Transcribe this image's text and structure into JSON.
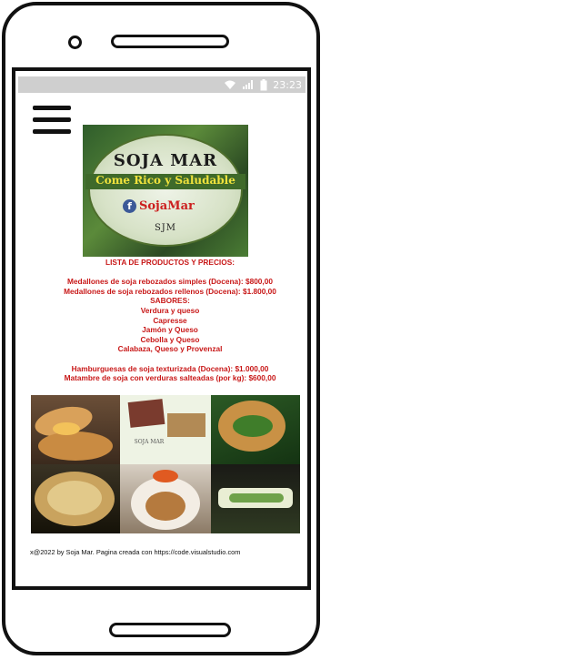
{
  "status_bar": {
    "time": "23:23",
    "icons": [
      "wifi-icon",
      "signal-icon",
      "battery-icon"
    ]
  },
  "menu": {
    "icon": "hamburger-menu-icon"
  },
  "logo": {
    "title": "SOJA MAR",
    "slogan": "Come Rico y Saludable",
    "facebook_name": "SojaMar",
    "monogram": "SJM"
  },
  "products": {
    "heading": "LISTA DE PRODUCTOS Y PRECIOS:",
    "items_a": [
      "Medallones de soja rebozados simples (Docena): $800,00",
      "Medallones de soja rebozados rellenos (Docena): $1.800,00"
    ],
    "flavors_heading": "SABORES:",
    "flavors": [
      "Verdura y queso",
      "Capresse",
      "Jamón y Queso",
      "Cebolla y Queso",
      "Calabaza, Queso y Provenzal"
    ],
    "items_b": [
      "Hamburguesas de soja texturizada (Docena): $1.000,00",
      "Matambre de soja con verduras salteadas (por kg): $600,00"
    ]
  },
  "gallery": {
    "photos": [
      "empanadas-photo",
      "soja-mar-flyer-photo",
      "stuffed-medallion-photo",
      "pie-photo",
      "plated-medallion-photo",
      "matambre-photo"
    ],
    "flyer_text": "SOJA MAR"
  },
  "footer": {
    "text": "x@2022 by Soja Mar. Pagina creada con https://code.visualstudio.com"
  },
  "colors": {
    "accent_red": "#c81818",
    "status_bar": "#cfcfcf",
    "frame": "#111111"
  }
}
